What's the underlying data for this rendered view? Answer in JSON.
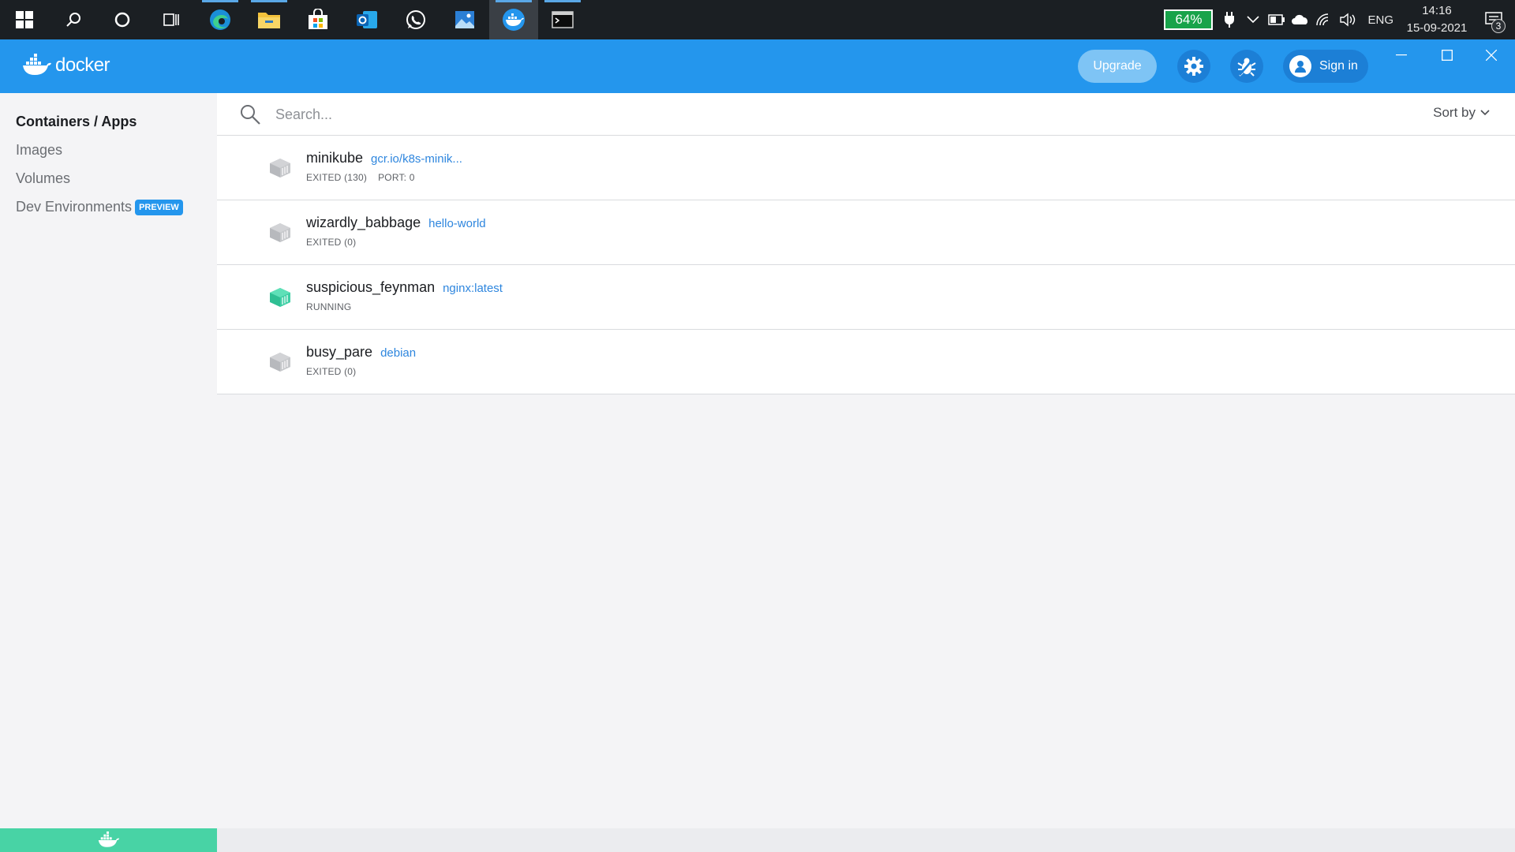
{
  "taskbar": {
    "apps": [
      "start",
      "search",
      "cortana",
      "task-view",
      "edge",
      "file-explorer",
      "microsoft-store",
      "outlook",
      "whatsapp",
      "photos",
      "docker-desktop",
      "terminal"
    ],
    "battery_text": "64%",
    "language": "ENG",
    "time": "14:16",
    "date": "15-09-2021",
    "notification_count": "3"
  },
  "header": {
    "logo_text": "docker",
    "upgrade_label": "Upgrade",
    "signin_label": "Sign in",
    "accent_color": "#2496ed"
  },
  "sidebar": {
    "items": [
      {
        "label": "Containers / Apps",
        "active": true
      },
      {
        "label": "Images",
        "active": false
      },
      {
        "label": "Volumes",
        "active": false
      },
      {
        "label": "Dev Environments",
        "active": false,
        "badge": "PREVIEW"
      }
    ]
  },
  "search": {
    "placeholder": "Search...",
    "value": ""
  },
  "sort": {
    "label": "Sort by"
  },
  "containers": [
    {
      "name": "minikube",
      "image": "gcr.io/k8s-minik...",
      "status": "EXITED (130)",
      "port": "PORT: 0",
      "running": false
    },
    {
      "name": "wizardly_babbage",
      "image": "hello-world",
      "status": "EXITED (0)",
      "port": "",
      "running": false
    },
    {
      "name": "suspicious_feynman",
      "image": "nginx:latest",
      "status": "RUNNING",
      "port": "",
      "running": true
    },
    {
      "name": "busy_pare",
      "image": "debian",
      "status": "EXITED (0)",
      "port": "",
      "running": false
    }
  ],
  "colors": {
    "running": "#3ecfa5",
    "exited": "#b7b9bd",
    "footer": "#48d3a5"
  }
}
